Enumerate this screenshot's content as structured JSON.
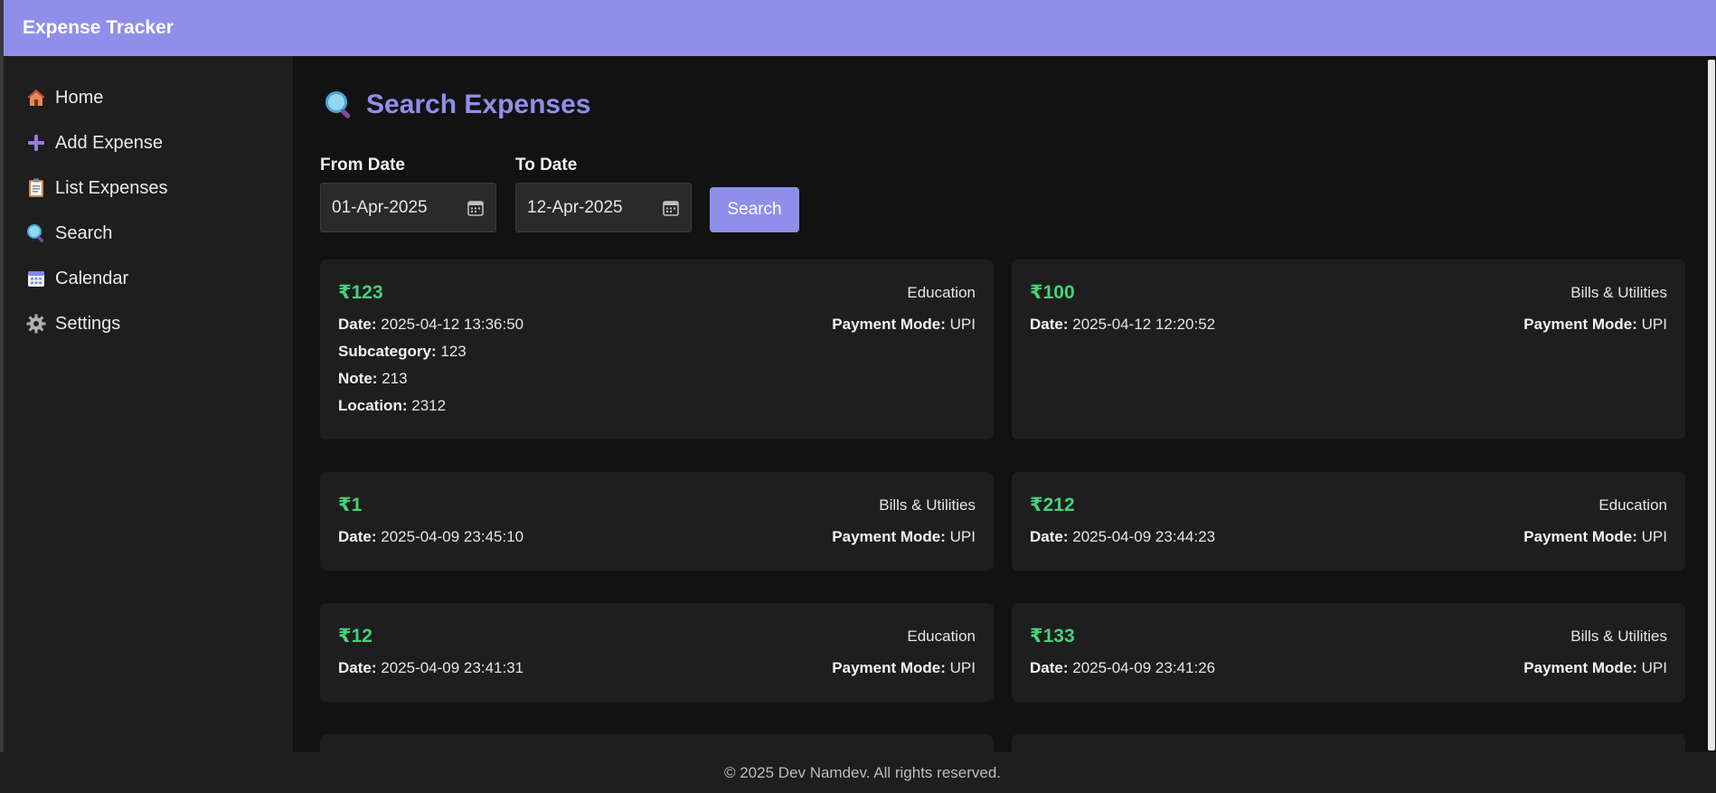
{
  "app": {
    "title": "Expense Tracker"
  },
  "sidebar": {
    "items": [
      {
        "label": "Home",
        "icon": "house-icon"
      },
      {
        "label": "Add Expense",
        "icon": "plus-icon"
      },
      {
        "label": "List Expenses",
        "icon": "clipboard-icon"
      },
      {
        "label": "Search",
        "icon": "magnifier-icon"
      },
      {
        "label": "Calendar",
        "icon": "calendar-icon"
      },
      {
        "label": "Settings",
        "icon": "gear-icon"
      }
    ]
  },
  "search": {
    "title": "Search Expenses",
    "from_label": "From Date",
    "from_value": "01-Apr-2025",
    "to_label": "To Date",
    "to_value": "12-Apr-2025",
    "button_label": "Search"
  },
  "field_labels": {
    "date": "Date:",
    "payment_mode": "Payment Mode:",
    "subcategory": "Subcategory:",
    "note": "Note:",
    "location": "Location:"
  },
  "expenses": [
    {
      "amount": "₹123",
      "category": "Education",
      "date": "2025-04-12 13:36:50",
      "payment_mode": "UPI",
      "subcategory": "123",
      "note": "213",
      "location": "2312"
    },
    {
      "amount": "₹100",
      "category": "Bills & Utilities",
      "date": "2025-04-12 12:20:52",
      "payment_mode": "UPI"
    },
    {
      "amount": "₹1",
      "category": "Bills & Utilities",
      "date": "2025-04-09 23:45:10",
      "payment_mode": "UPI"
    },
    {
      "amount": "₹212",
      "category": "Education",
      "date": "2025-04-09 23:44:23",
      "payment_mode": "UPI"
    },
    {
      "amount": "₹12",
      "category": "Education",
      "date": "2025-04-09 23:41:31",
      "payment_mode": "UPI"
    },
    {
      "amount": "₹133",
      "category": "Bills & Utilities",
      "date": "2025-04-09 23:41:26",
      "payment_mode": "UPI"
    }
  ],
  "footer": {
    "text": "© 2025 Dev Namdev. All rights reserved."
  },
  "colors": {
    "accent": "#8f8fea",
    "amount": "#46d27a",
    "background": "#121212",
    "card": "#1e1e1e"
  }
}
